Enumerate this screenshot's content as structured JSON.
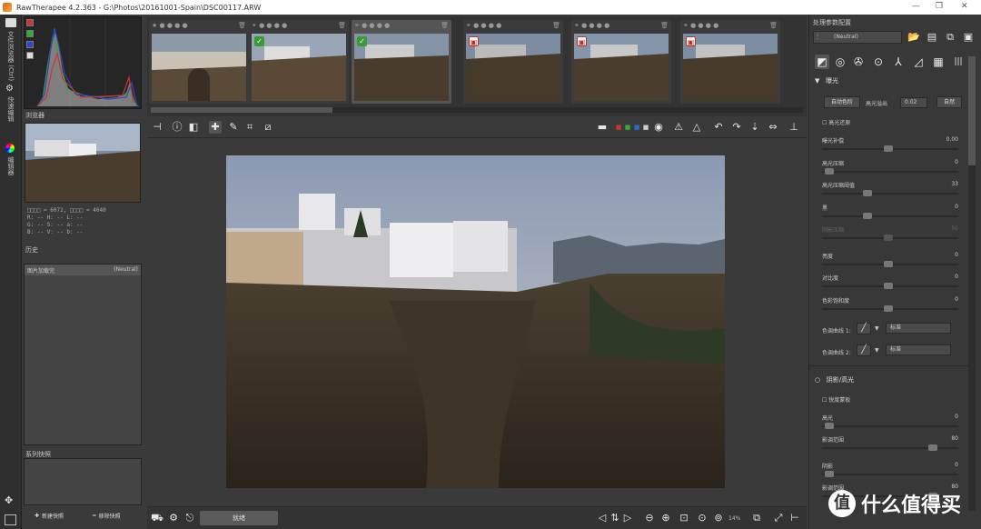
{
  "window": {
    "title": "RawTherapee 4.2.363 - G:\\Photos\\20161001-Spain\\DSC00117.ARW"
  },
  "left_strip": {
    "item1": "文件浏览器 (Ctrl)",
    "item2": "快速编辑",
    "item3": "编辑器"
  },
  "navigator": {
    "title": "浏览器",
    "dims_row": "□□□□ = 6072, □□□□ = 4040",
    "rows": [
      "R:  --   H:  --   L:  --",
      "G:  --   S:  --   a:  --",
      "B:  --   V:  --   b:  --"
    ]
  },
  "history": {
    "title": "历史",
    "row_label": "图片加载完",
    "row_value": "(Neutral)"
  },
  "snapshots": {
    "title": "系列快照",
    "add": "新建快照",
    "remove": "移除快照"
  },
  "bottombar": {
    "status": "就绪",
    "zoom": "14%"
  },
  "right": {
    "title": "处理参数配置",
    "profile": "(Neutral)",
    "exposure": {
      "header": "曝光",
      "auto_label": "自动色阶",
      "clip_label": "高光溢出",
      "clip_value": "0.02",
      "default_label": "自然",
      "hl_recovery": "高光还原",
      "params": [
        {
          "label": "曝光补偿",
          "value": "0.00"
        },
        {
          "label": "高光压缩",
          "value": "0"
        },
        {
          "label": "高光压缩阈值",
          "value": "33"
        },
        {
          "label": "黑",
          "value": "0"
        },
        {
          "label": "阴影压缩",
          "value": "50"
        },
        {
          "label": "亮度",
          "value": "0"
        },
        {
          "label": "对比度",
          "value": "0"
        },
        {
          "label": "色彩饱和度",
          "value": "0"
        }
      ],
      "curve1_label": "色调曲线 1:",
      "curve1_mode": "标准",
      "curve2_label": "色调曲线 2:",
      "curve2_mode": "标准"
    },
    "shadows": {
      "header": "阴影/高光",
      "sharp_mask": "锐度蒙板",
      "params": [
        {
          "label": "高光",
          "value": "0"
        },
        {
          "label": "影调范围",
          "value": "80"
        },
        {
          "label": "阴影",
          "value": "0"
        },
        {
          "label": "影调范围",
          "value": "80"
        }
      ]
    }
  },
  "watermark": {
    "text": "什么值得买"
  },
  "colors": {
    "accent": "#3c6fd6",
    "check": "#3a9a3a",
    "flag": "#c0302a"
  }
}
